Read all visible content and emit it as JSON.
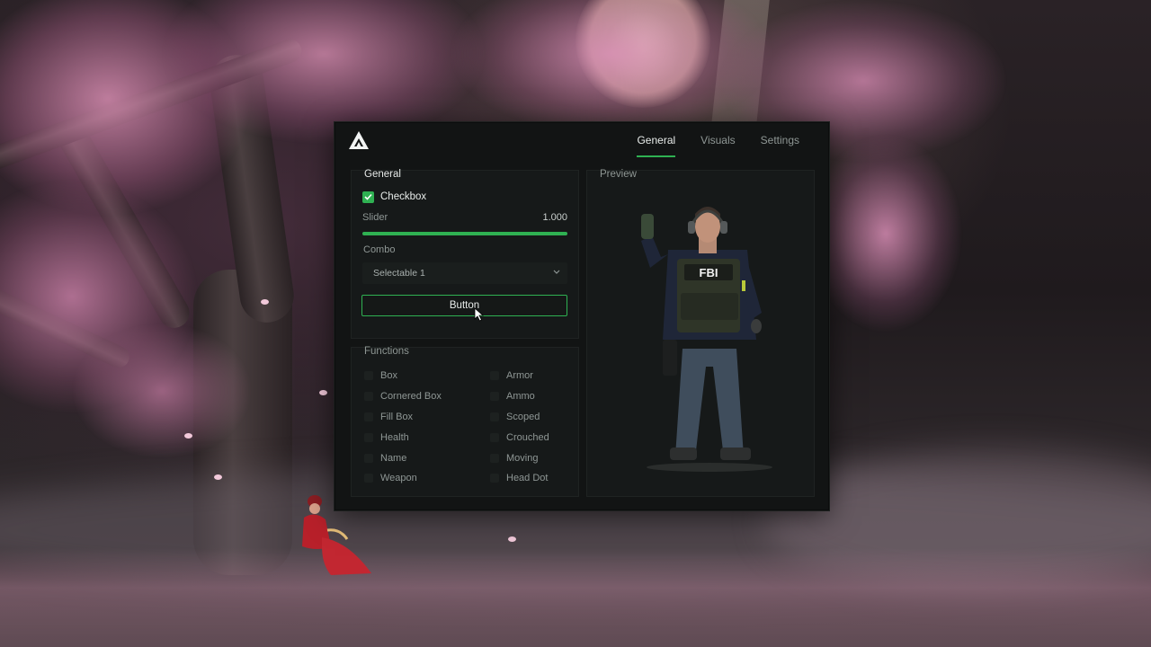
{
  "menu": {
    "logo": "triangle-logo-icon",
    "tabs": [
      {
        "label": "General",
        "active": true
      },
      {
        "label": "Visuals",
        "active": false
      },
      {
        "label": "Settings",
        "active": false
      }
    ],
    "accent_color": "#2fb152"
  },
  "general": {
    "title": "General",
    "checkbox": {
      "label": "Checkbox",
      "checked": true
    },
    "slider": {
      "label": "Slider",
      "value": "1.000",
      "fill_fraction": 1.0
    },
    "combo": {
      "label": "Combo",
      "value": "Selectable 1"
    },
    "button": {
      "label": "Button"
    }
  },
  "functions": {
    "title": "Functions",
    "items": [
      {
        "label": "Box",
        "checked": false
      },
      {
        "label": "Armor",
        "checked": false
      },
      {
        "label": "Cornered Box",
        "checked": false
      },
      {
        "label": "Ammo",
        "checked": false
      },
      {
        "label": "Fill Box",
        "checked": false
      },
      {
        "label": "Scoped",
        "checked": false
      },
      {
        "label": "Health",
        "checked": false
      },
      {
        "label": "Crouched",
        "checked": false
      },
      {
        "label": "Name",
        "checked": false
      },
      {
        "label": "Moving",
        "checked": false
      },
      {
        "label": "Weapon",
        "checked": false
      },
      {
        "label": "Head Dot",
        "checked": false
      }
    ]
  },
  "preview": {
    "title": "Preview",
    "vest_text": "FBI"
  }
}
